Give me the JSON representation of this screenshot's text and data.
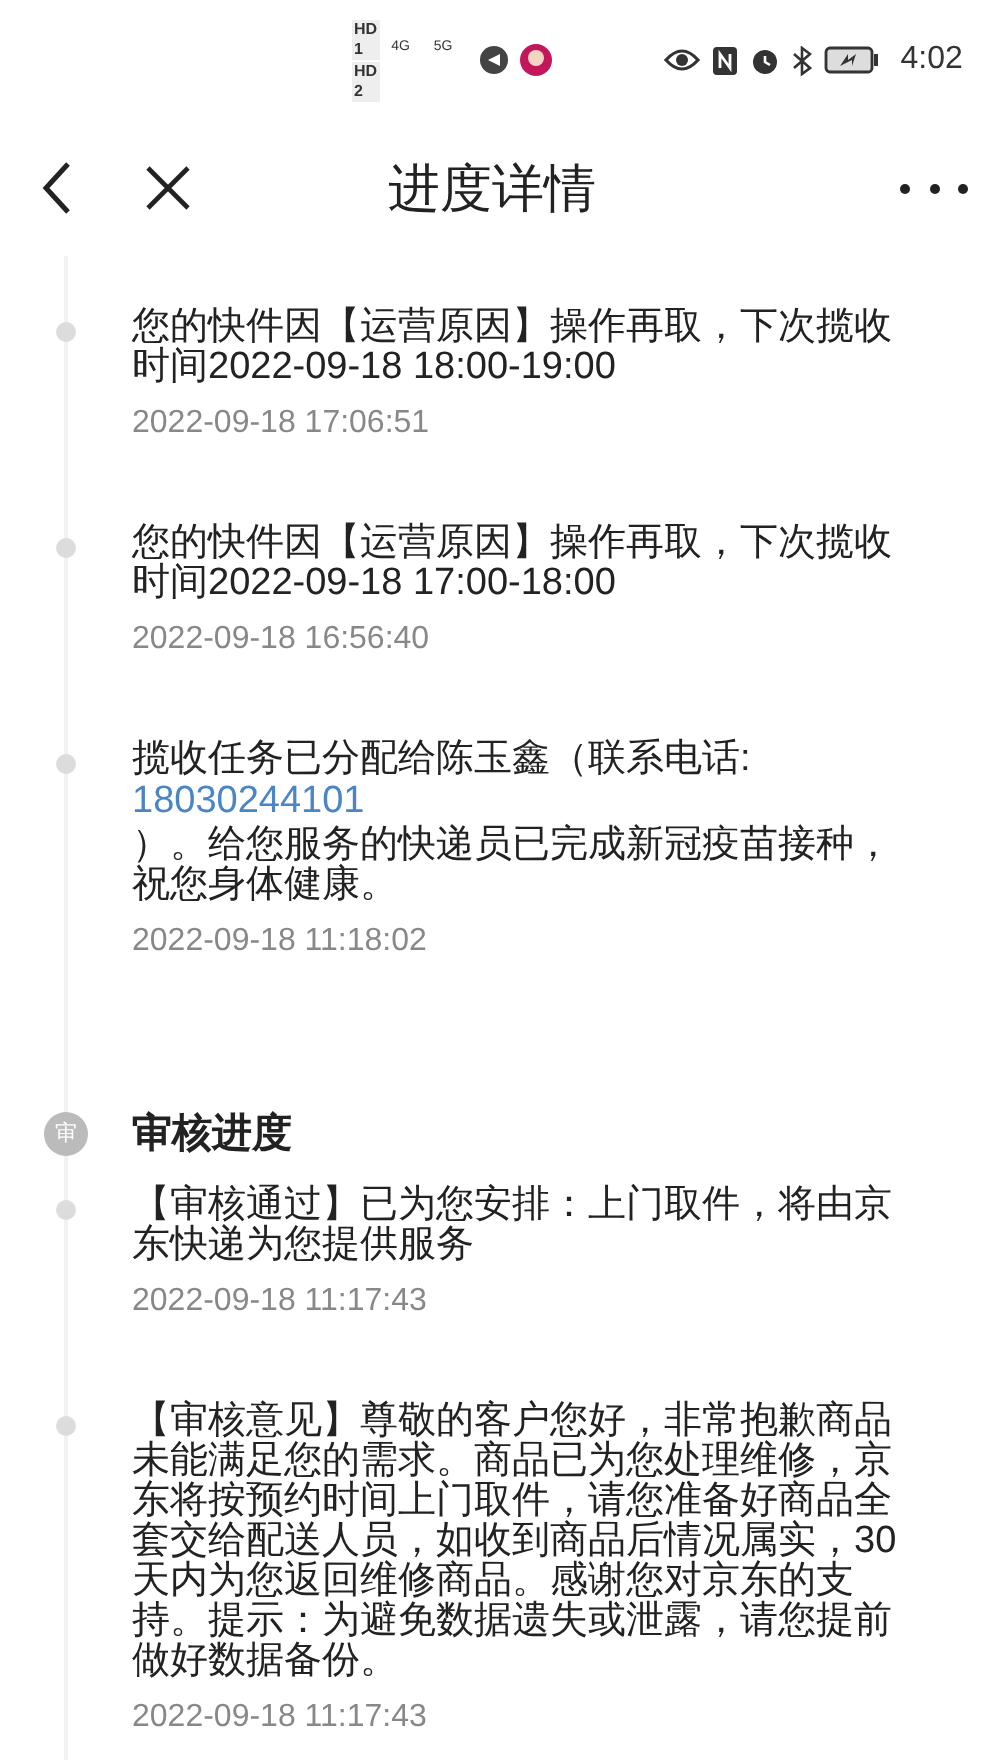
{
  "status_bar": {
    "sim_labels": [
      "HD 1",
      "HD 2"
    ],
    "networks": [
      "4G",
      "5G"
    ],
    "time": "4:02"
  },
  "header": {
    "title": "进度详情"
  },
  "timeline": [
    {
      "kind": "event",
      "text": "您的快件因【运营原因】操作再取，下次揽收时间2022-09-18 18:00-19:00",
      "timestamp": "2022-09-18 17:06:51"
    },
    {
      "kind": "event",
      "text": "您的快件因【运营原因】操作再取，下次揽收时间2022-09-18 17:00-18:00",
      "timestamp": "2022-09-18 16:56:40"
    },
    {
      "kind": "event",
      "text": "揽收任务已分配给陈玉鑫（联系电话:",
      "phone": "18030244101",
      "text_after": "）。给您服务的快递员已完成新冠疫苗接种，祝您身体健康。",
      "timestamp": "2022-09-18 11:18:02"
    },
    {
      "kind": "section",
      "icon_text": "审",
      "title": "审核进度"
    },
    {
      "kind": "event",
      "text": "【审核通过】已为您安排：上门取件，将由京东快递为您提供服务",
      "timestamp": "2022-09-18 11:17:43"
    },
    {
      "kind": "event",
      "text": "【审核意见】尊敬的客户您好，非常抱歉商品未能满足您的需求。商品已为您处理维修，京东将按预约时间上门取件，请您准备好商品全套交给配送人员，如收到商品后情况属实，30天内为您返回维修商品。感谢您对京东的支持。提示：为避免数据遗失或泄露，请您提前做好数据备份。",
      "timestamp": "2022-09-18 11:17:43"
    }
  ]
}
